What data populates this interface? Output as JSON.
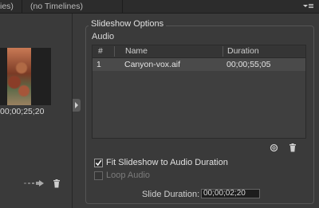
{
  "tabs": {
    "left_partial": "ies)",
    "right": "(no Timelines)"
  },
  "left_panel": {
    "timecode": "00;00;25;20"
  },
  "slideshow": {
    "title": "Slideshow Options",
    "audio_label": "Audio",
    "columns": [
      "#",
      "Name",
      "Duration"
    ],
    "rows": [
      {
        "num": "1",
        "name": "Canyon-vox.aif",
        "duration": "00;00;55;05"
      }
    ],
    "fit_label": "Fit Slideshow to Audio Duration",
    "fit_checked": true,
    "loop_label": "Loop Audio",
    "loop_checked": false,
    "slide_duration_label": "Slide Duration:",
    "slide_duration_value": "00;00;02;20"
  },
  "icons": {
    "panel_menu": "panel-menu-icon",
    "loop": "loop-icon",
    "trash": "trash-icon",
    "slideshow_arrow": "slideshow-arrow-icon",
    "collapse": "collapse-arrow-icon"
  },
  "colors": {
    "panel_bg": "#3a3a3a",
    "selected_row": "#4a4a4a",
    "tab_bg": "#2c2c2c"
  }
}
